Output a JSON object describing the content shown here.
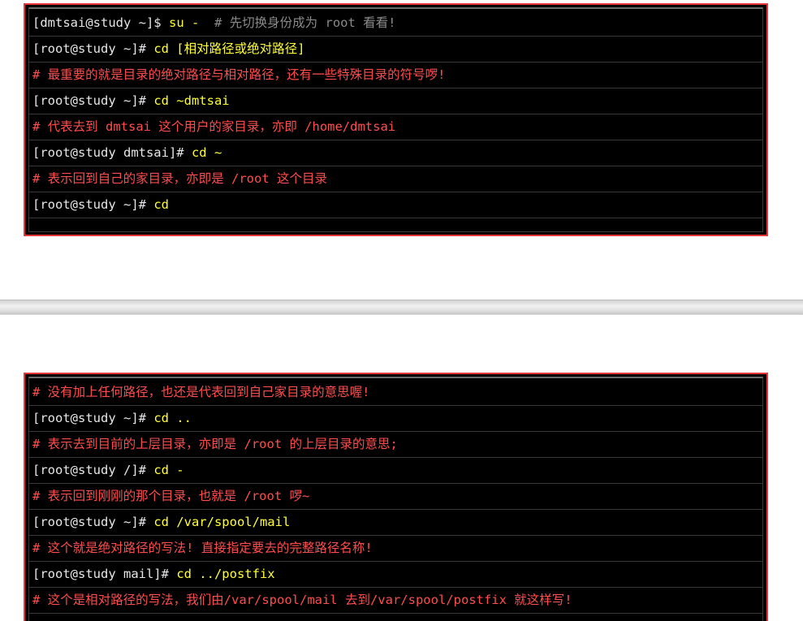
{
  "top_terminal": {
    "lines": [
      {
        "prompt": "[dmtsai@study ~]$ ",
        "command": "su - ",
        "comment": " # 先切换身份成为 root 看看!"
      },
      {
        "prompt": "[root@study ~]# ",
        "command": "cd [相对路径或绝对路径]",
        "comment": ""
      },
      {
        "prompt": "",
        "command": "",
        "comment": "# 最重要的就是目录的绝对路径与相对路径，还有一些特殊目录的符号啰!"
      },
      {
        "prompt": "[root@study ~]# ",
        "command": "cd ~dmtsai",
        "comment": ""
      },
      {
        "prompt": "",
        "command": "",
        "comment": "# 代表去到 dmtsai 这个用户的家目录，亦即 /home/dmtsai"
      },
      {
        "prompt": "[root@study dmtsai]# ",
        "command": "cd ~",
        "comment": ""
      },
      {
        "prompt": "",
        "command": "",
        "comment": "# 表示回到自己的家目录，亦即是 /root 这个目录"
      },
      {
        "prompt": "[root@study ~]# ",
        "command": "cd",
        "comment": ""
      }
    ]
  },
  "bottom_terminal": {
    "lines": [
      {
        "prompt": "",
        "command": "",
        "comment": "# 没有加上任何路径，也还是代表回到自己家目录的意思喔!"
      },
      {
        "prompt": "[root@study ~]# ",
        "command": "cd ..",
        "comment": ""
      },
      {
        "prompt": "",
        "command": "",
        "comment": "# 表示去到目前的上层目录，亦即是 /root 的上层目录的意思;"
      },
      {
        "prompt": "[root@study /]# ",
        "command": "cd -",
        "comment": ""
      },
      {
        "prompt": "",
        "command": "",
        "comment": "# 表示回到刚刚的那个目录，也就是 /root 啰~"
      },
      {
        "prompt": "[root@study ~]# ",
        "command": "cd /var/spool/mail",
        "comment": ""
      },
      {
        "prompt": "",
        "command": "",
        "comment": "# 这个就是绝对路径的写法! 直接指定要去的完整路径名称!"
      },
      {
        "prompt": "[root@study mail]# ",
        "command": "cd ../postfix",
        "comment": ""
      },
      {
        "prompt": "",
        "command": "",
        "comment": "# 这个是相对路径的写法，我们由/var/spool/mail 去到/var/spool/postfix 就这样写!"
      }
    ]
  },
  "colors": {
    "frame_border": "#e8323c",
    "terminal_bg": "#000000",
    "prompt_text": "#e6e6e6",
    "command_text": "#ffff33",
    "comment_red": "#ff4d4d",
    "comment_gray": "#8a8a8a"
  }
}
